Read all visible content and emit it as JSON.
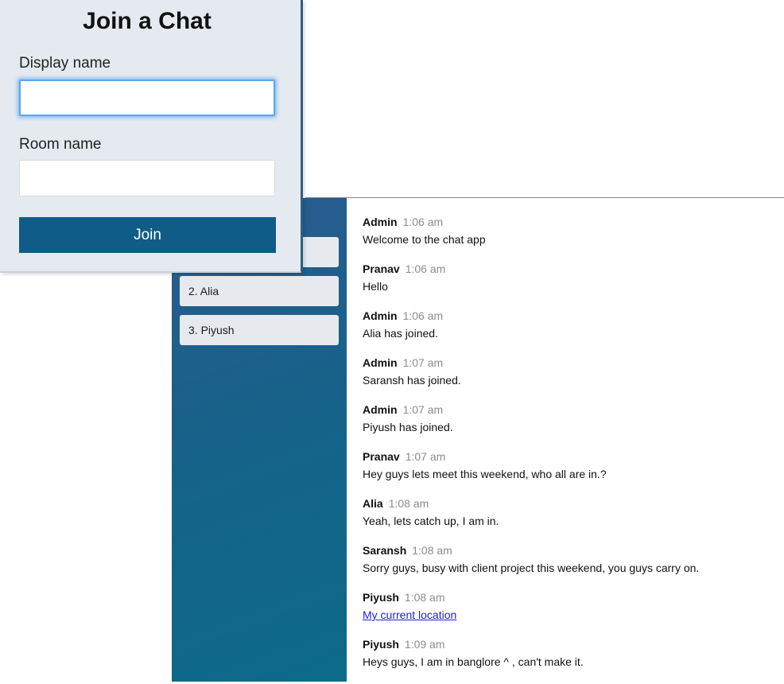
{
  "join_form": {
    "title": "Join a Chat",
    "display_name_label": "Display name",
    "display_name_value": "",
    "room_name_label": "Room name",
    "room_name_value": "",
    "join_label": "Join"
  },
  "sidebar": {
    "users": [
      {
        "label": ""
      },
      {
        "label": "2. Alia"
      },
      {
        "label": "3. Piyush"
      }
    ]
  },
  "messages": [
    {
      "author": "Admin",
      "time": "1:06 am",
      "text": "Welcome to the chat app"
    },
    {
      "author": "Pranav",
      "time": "1:06 am",
      "text": "Hello"
    },
    {
      "author": "Admin",
      "time": "1:06 am",
      "text": "Alia has joined."
    },
    {
      "author": "Admin",
      "time": "1:07 am",
      "text": "Saransh has joined."
    },
    {
      "author": "Admin",
      "time": "1:07 am",
      "text": "Piyush has joined."
    },
    {
      "author": "Pranav",
      "time": "1:07 am",
      "text": "Hey guys lets meet this weekend, who all are in.?"
    },
    {
      "author": "Alia",
      "time": "1:08 am",
      "text": "Yeah, lets catch up, I am in."
    },
    {
      "author": "Saransh",
      "time": "1:08 am",
      "text": "Sorry guys, busy with client project this weekend, you guys carry on."
    },
    {
      "author": "Piyush",
      "time": "1:08 am",
      "link_text": "My current location"
    },
    {
      "author": "Piyush",
      "time": "1:09 am",
      "text": "Heys guys, I am in banglore ^ , can't make it."
    }
  ],
  "colors": {
    "sidebar_top": "#2a5b8f",
    "sidebar_bottom": "#0c6a8a",
    "join_button": "#0f5d86",
    "focus_ring": "#5aa7ef",
    "link": "#1f1fd6"
  }
}
